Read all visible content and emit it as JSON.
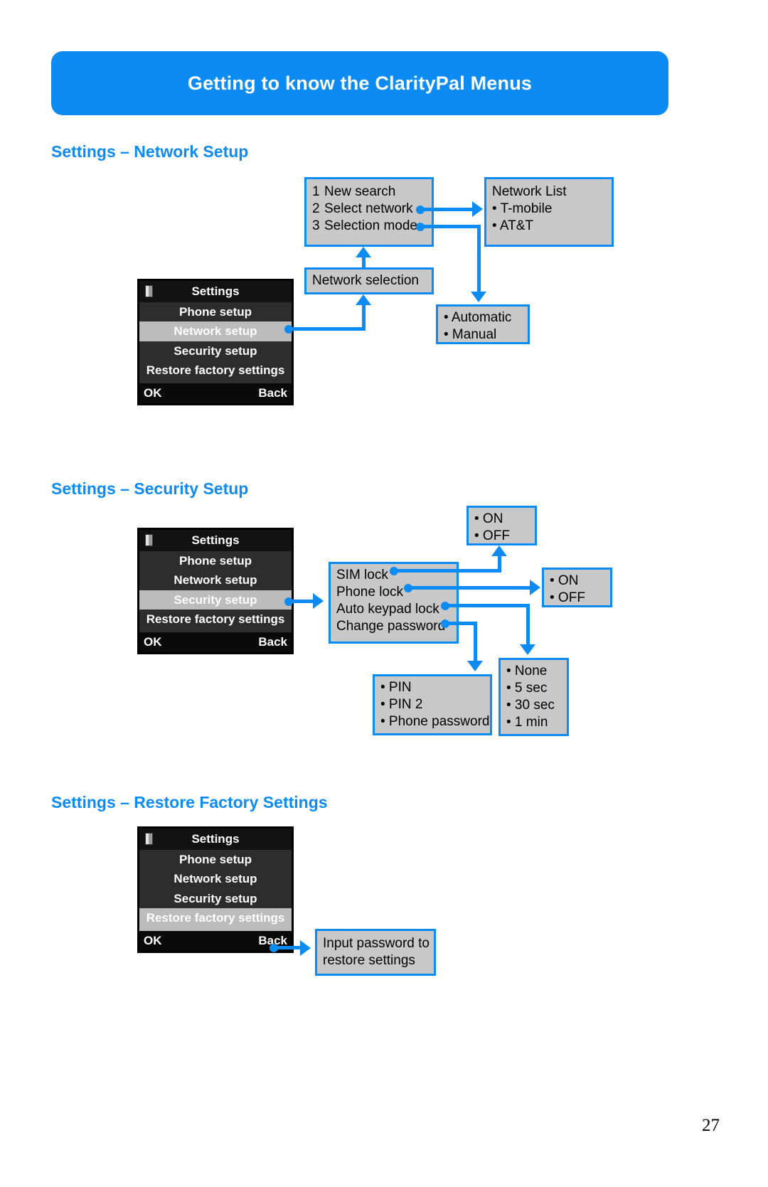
{
  "banner": {
    "title": "Getting to know the ClarityPal Menus"
  },
  "page": {
    "number": "27"
  },
  "sections": [
    {
      "heading": "Settings – Network Setup",
      "phone": {
        "title": "Settings",
        "items": [
          {
            "label": "Phone setup",
            "selected": false
          },
          {
            "label": "Network setup",
            "selected": true
          },
          {
            "label": "Security setup",
            "selected": false
          },
          {
            "label": "Restore factory settings",
            "selected": false
          }
        ],
        "softkey_left": "OK",
        "softkey_right": "Back"
      },
      "boxes": {
        "network_selection": {
          "lines": [
            "Network selection"
          ]
        },
        "options": {
          "rows": [
            {
              "num": "1",
              "text": "New search"
            },
            {
              "num": "2",
              "text": "Select network"
            },
            {
              "num": "3",
              "text": "Selection mode"
            }
          ]
        },
        "network_list": {
          "lines": [
            "Network List",
            "• T-mobile",
            "• AT&T"
          ]
        },
        "selection_mode": {
          "lines": [
            "• Automatic",
            "• Manual"
          ]
        }
      }
    },
    {
      "heading": "Settings – Security Setup",
      "phone": {
        "title": "Settings",
        "items": [
          {
            "label": "Phone setup",
            "selected": false
          },
          {
            "label": "Network setup",
            "selected": false
          },
          {
            "label": "Security setup",
            "selected": true
          },
          {
            "label": "Restore factory settings",
            "selected": false
          }
        ],
        "softkey_left": "OK",
        "softkey_right": "Back"
      },
      "boxes": {
        "security_menu": {
          "lines": [
            "SIM lock",
            "Phone lock",
            "Auto keypad lock",
            "Change password"
          ]
        },
        "sim_lock_options": {
          "lines": [
            "• ON",
            "• OFF"
          ]
        },
        "phone_lock_options": {
          "lines": [
            "• ON",
            "• OFF"
          ]
        },
        "password_options": {
          "lines": [
            "• PIN",
            "• PIN 2",
            "• Phone password"
          ]
        },
        "keypad_lock_options": {
          "lines": [
            "• None",
            "• 5 sec",
            "• 30 sec",
            "• 1 min"
          ]
        }
      }
    },
    {
      "heading": "Settings – Restore Factory Settings",
      "phone": {
        "title": "Settings",
        "items": [
          {
            "label": "Phone setup",
            "selected": false
          },
          {
            "label": "Network setup",
            "selected": false
          },
          {
            "label": "Security setup",
            "selected": false
          },
          {
            "label": "Restore factory settings",
            "selected": true
          }
        ],
        "softkey_left": "OK",
        "softkey_right": "Back"
      },
      "boxes": {
        "input_password": {
          "lines": [
            "Input password to",
            "restore settings"
          ]
        }
      }
    }
  ],
  "colors": {
    "accent": "#0c8bf2",
    "box_fill": "#c8c8c8",
    "screen_bg": "#2d2d2d",
    "selected_row": "#bcbcbc"
  }
}
